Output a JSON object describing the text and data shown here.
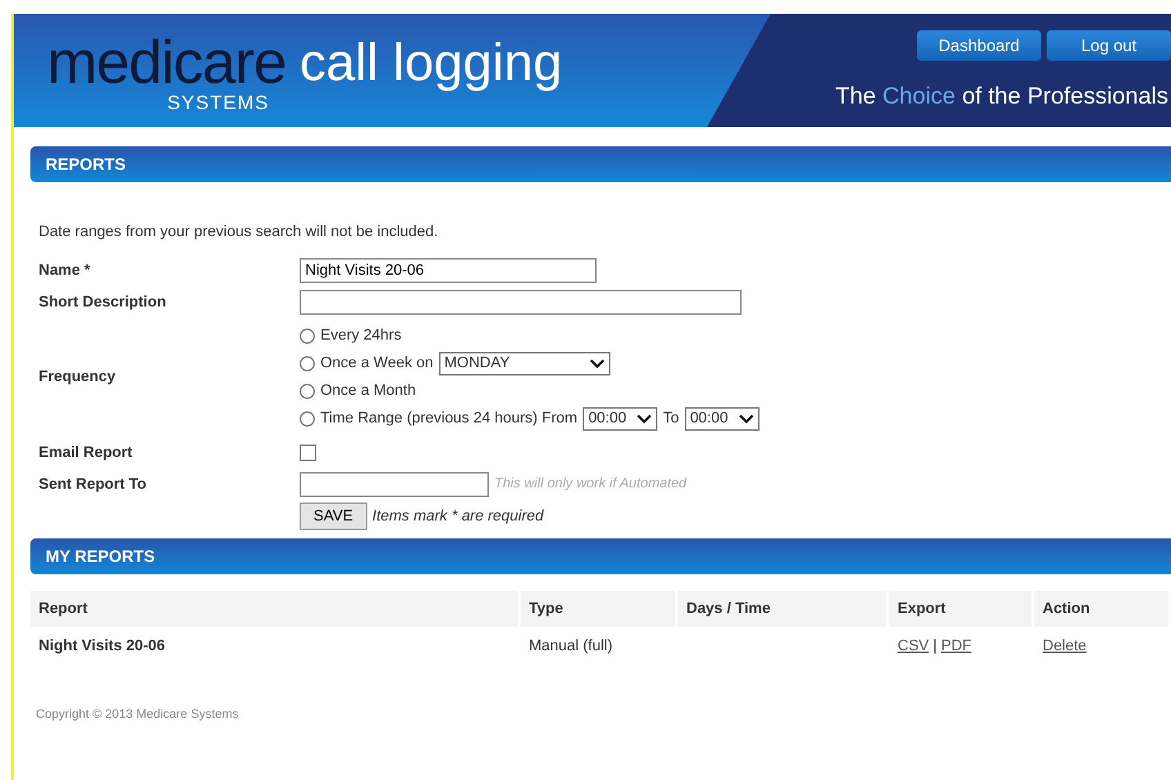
{
  "header": {
    "brand": "medicare",
    "brand_sub": "SYSTEMS",
    "product": "call logging",
    "tagline": {
      "prefix": "The",
      "highlight": "Choice",
      "suffix": "of the Professionals"
    },
    "buttons": [
      "Dashboard",
      "Log out"
    ]
  },
  "reports_section": {
    "title": "REPORTS",
    "note": "Date ranges from your previous search will not be included.",
    "form": {
      "name": {
        "label": "Name *",
        "value": "Night Visits 20-06"
      },
      "short_description": {
        "label": "Short Description"
      },
      "frequency": {
        "label": "Frequency",
        "options": [
          {
            "kind": "plain",
            "label": "Every 24hrs",
            "selected": false
          },
          {
            "kind": "weekday",
            "label": "Once a Week on",
            "select": "MONDAY",
            "selected": false
          },
          {
            "kind": "plain",
            "label": "Once a Month",
            "selected": false
          },
          {
            "kind": "range",
            "label": "Time Range (previous 24 hours) From",
            "from": "00:00",
            "to_label": "To",
            "to": "00:00",
            "selected": false
          }
        ]
      },
      "email_report": {
        "label": "Email Report",
        "checked": false
      },
      "sent_to": {
        "label": "Sent Report To",
        "hint": "This will only work if Automated"
      },
      "save": {
        "button": "SAVE",
        "note": "Items mark * are required"
      }
    }
  },
  "my_reports": {
    "title": "MY REPORTS",
    "table": {
      "columns": [
        "Report",
        "Type",
        "Days / Time",
        "Export",
        "Action"
      ],
      "rows": [
        {
          "report": "Night Visits 20-06",
          "type": "Manual (full)",
          "export": [
            "CSV",
            "PDF"
          ],
          "export_sep": "|",
          "action": "Delete"
        }
      ]
    }
  },
  "footer": "Copyright © 2013 Medicare Systems"
}
